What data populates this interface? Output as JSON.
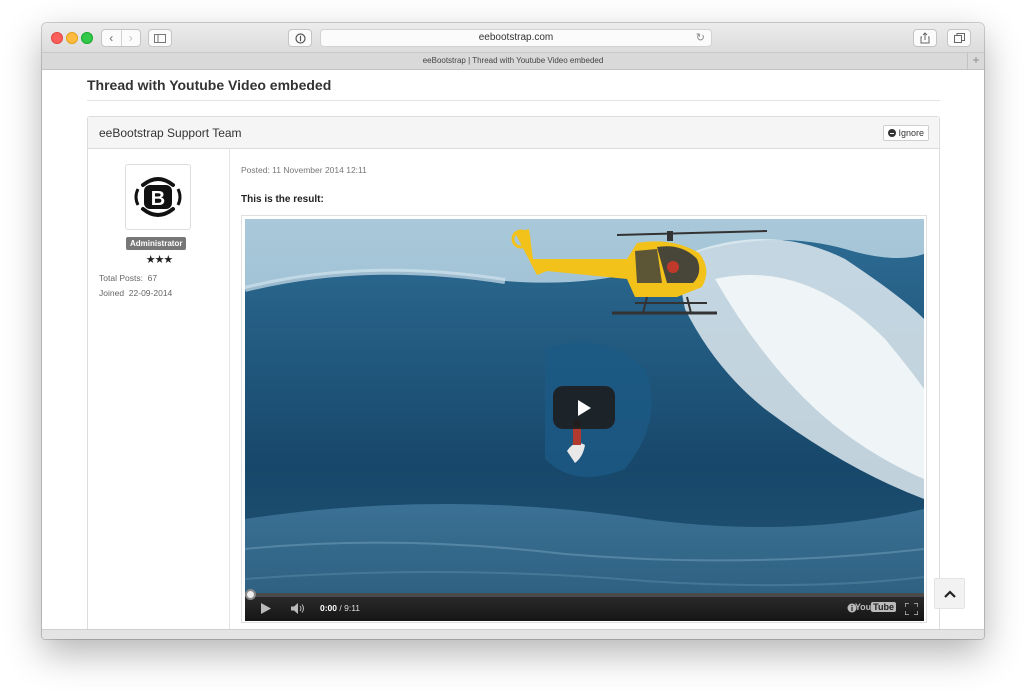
{
  "browser": {
    "url": "eebootstrap.com",
    "tab_title": "eeBootstrap | Thread with Youtube Video embeded"
  },
  "page": {
    "title": "Thread with Youtube Video embeded"
  },
  "post": {
    "author": "eeBootstrap Support Team",
    "ignore_label": "Ignore",
    "role": "Administrator",
    "stars": "★★★",
    "total_posts_label": "Total Posts:",
    "total_posts": "67",
    "joined_label": "Joined",
    "joined": "22-09-2014",
    "posted": "Posted: 11 November 2014 12:11",
    "text": "This is the result:"
  },
  "video": {
    "current_time": "0:00",
    "duration": "/ 9:11",
    "logo_you": "You",
    "logo_tube": "Tube",
    "progress": 0
  },
  "colors": {
    "badge": "#777777",
    "helicopter": "#f2c21a",
    "traffic_red": "#fc605c",
    "traffic_yellow": "#fdbc40",
    "traffic_green": "#34c84a"
  },
  "icons": [
    "back-icon",
    "forward-icon",
    "sidebar-icon",
    "reader-icon",
    "reload-icon",
    "share-icon",
    "tabs-icon",
    "new-tab-icon",
    "minus-circle-icon",
    "play-icon",
    "volume-icon",
    "fullscreen-icon",
    "chevron-up-icon"
  ]
}
